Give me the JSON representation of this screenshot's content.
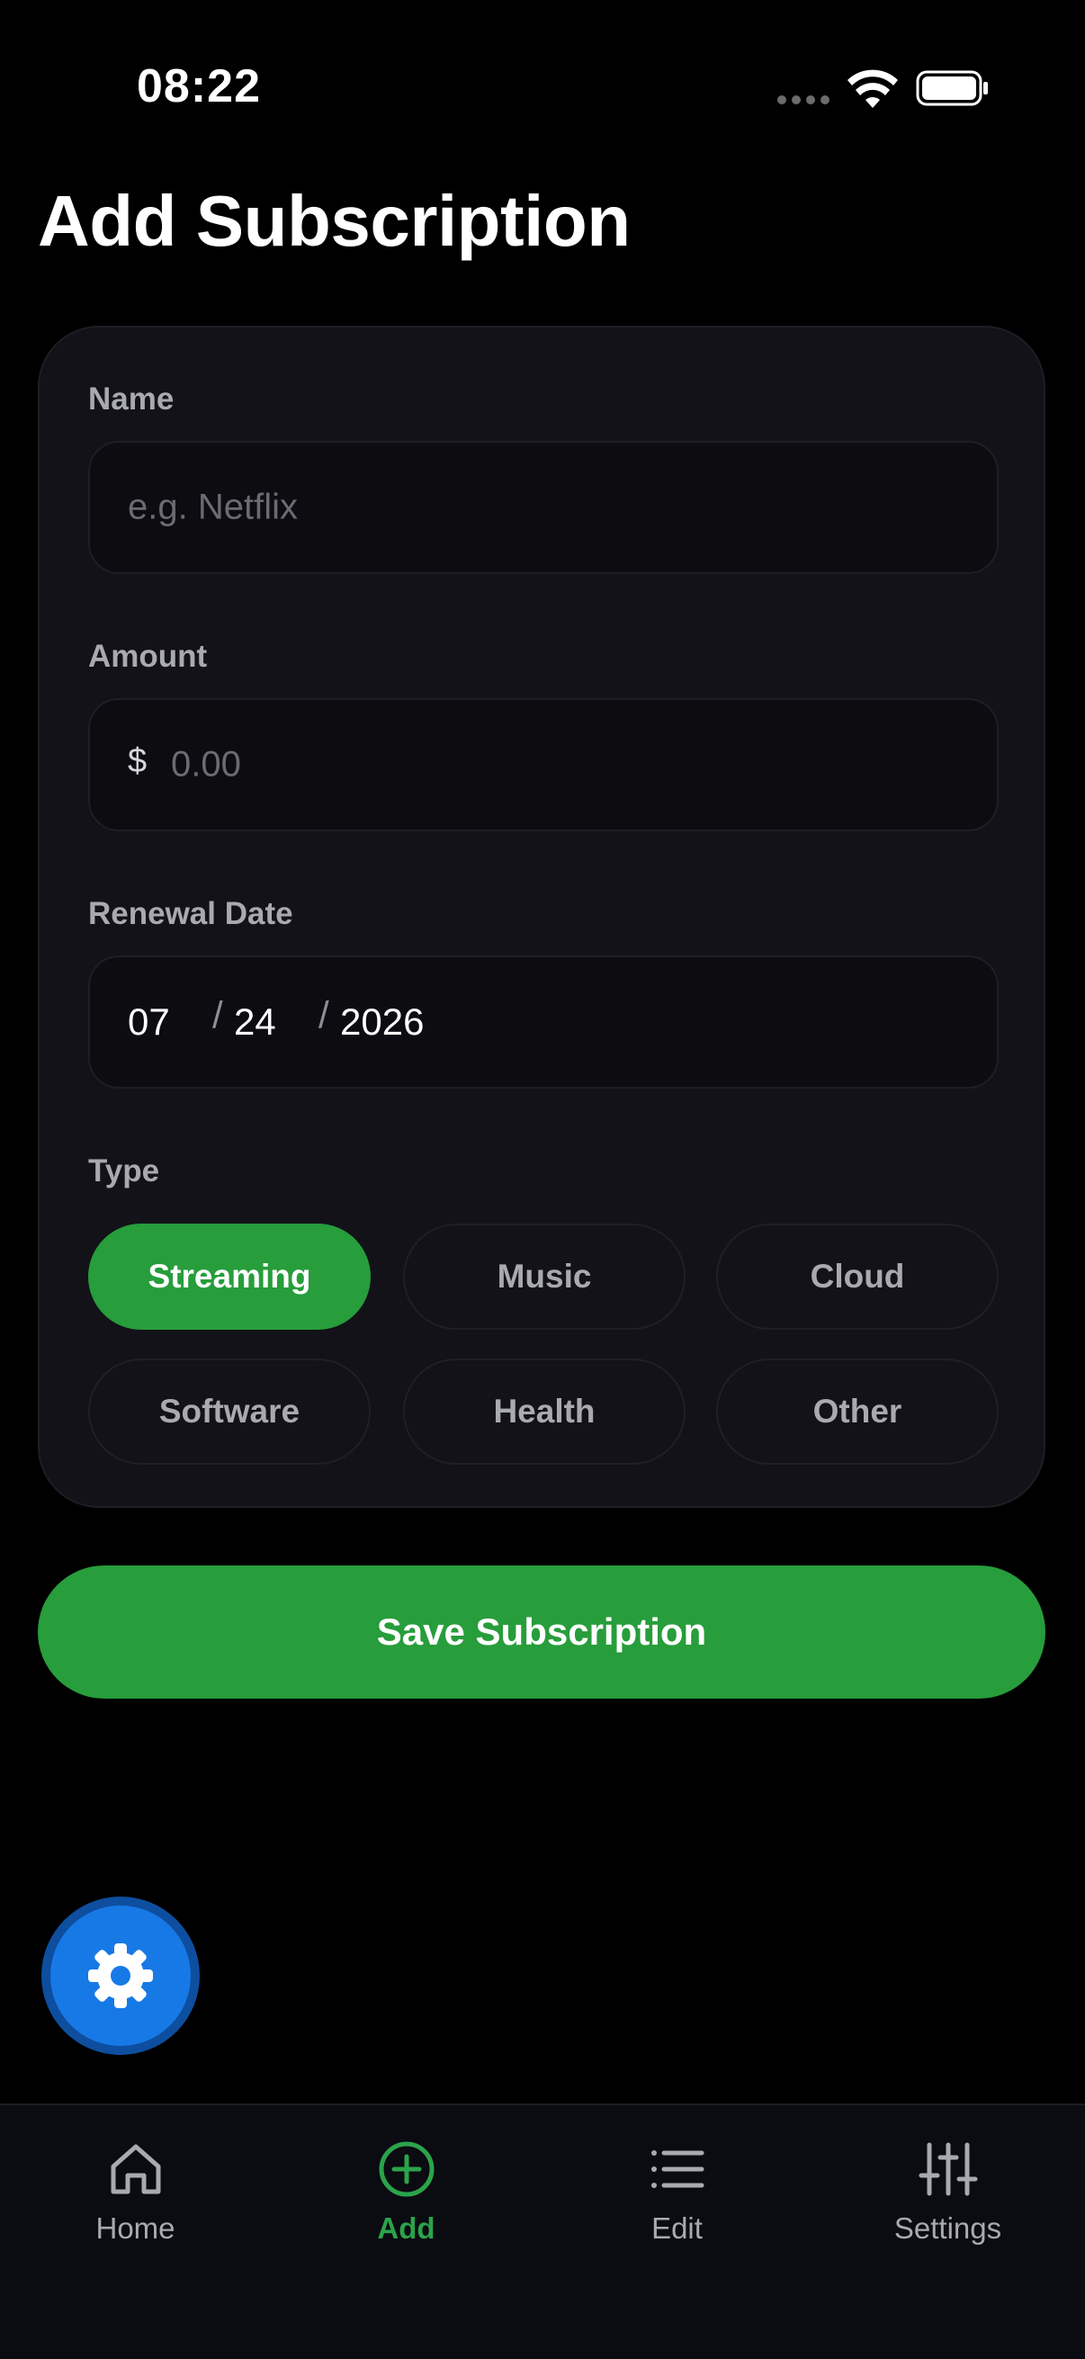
{
  "status_bar": {
    "time": "08:22",
    "icons": [
      "signal-dots-icon",
      "wifi-icon",
      "battery-icon"
    ]
  },
  "page": {
    "title": "Add Subscription"
  },
  "form": {
    "name": {
      "label": "Name",
      "value": "",
      "placeholder": "e.g. Netflix"
    },
    "amount": {
      "label": "Amount",
      "currency_symbol": "$",
      "value": "",
      "placeholder": "0.00"
    },
    "renewal_date": {
      "label": "Renewal Date",
      "month": "07",
      "day": "24",
      "year": "2026",
      "separator": "/"
    },
    "type": {
      "label": "Type",
      "options": [
        "Streaming",
        "Music",
        "Cloud",
        "Software",
        "Health",
        "Other"
      ],
      "selected": "Streaming"
    }
  },
  "actions": {
    "save_label": "Save Subscription"
  },
  "fab": {
    "icon": "gear-icon"
  },
  "tab_bar": {
    "items": [
      {
        "label": "Home",
        "icon": "home-icon"
      },
      {
        "label": "Add",
        "icon": "plus-circle-icon"
      },
      {
        "label": "Edit",
        "icon": "list-icon"
      },
      {
        "label": "Settings",
        "icon": "sliders-icon"
      }
    ],
    "active": "Add"
  },
  "colors": {
    "background": "#000000",
    "card": "#121218",
    "accent_green": "#279d3b",
    "active_tab_green": "#2ba34a",
    "fab_blue": "#1779e6",
    "muted_text": "#a9a9b1"
  }
}
